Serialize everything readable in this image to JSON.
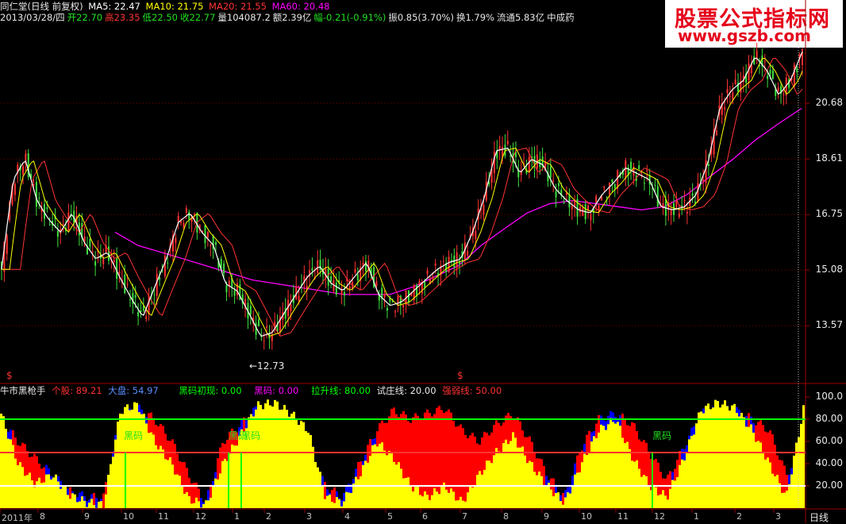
{
  "header": {
    "stock": "同仁堂(日线 前复权)",
    "ma5": "MA5: 22.47",
    "ma10": "MA10: 21.75",
    "ma20": "MA20: 21.55",
    "ma60": "MA60: 20.48",
    "date": "2013/03/28/四",
    "open": "开22.70",
    "high": "高23.35",
    "low": "低22.50",
    "close": "收22.77",
    "volume": "量104087.2",
    "amount": "额2.39亿",
    "change": "幅-0.21(-0.91%)",
    "amplitude": "振0.85(3.70%)",
    "turnover": "换1.79%",
    "float": "流通5.83亿",
    "industry": "中成药"
  },
  "watermark": {
    "line1": "股票公式指标网",
    "line2": "www.gszb.com"
  },
  "indicator_header": {
    "name": "牛市黑枪手",
    "ge_gu": "个股: 89.21",
    "da_pan": "大盘: 54.97",
    "hei_ma_chu_xian": "黑码初现: 0.00",
    "hei_ma": "黑码: 0.00",
    "la_sheng_xian": "拉升线: 80.00",
    "shi_zhuang_xian": "试庄线: 20.00",
    "qiang_ruo_xian": "强弱线: 50.00"
  },
  "price_ticks": [
    "20.68",
    "18.61",
    "16.75",
    "15.08",
    "13.57"
  ],
  "osc_ticks": [
    "100.0",
    "80.00",
    "60.00",
    "40.00",
    "20.00"
  ],
  "x_ticks": [
    "2011年",
    "8",
    "9",
    "10",
    "11",
    "12",
    "1",
    "2",
    "3",
    "4",
    "5",
    "6",
    "7",
    "8",
    "9",
    "10",
    "11",
    "12",
    "1",
    "2",
    "3"
  ],
  "period_label": "日线",
  "low_marker": "←12.73",
  "signal_labels": [
    "黑码",
    "黑码",
    "黑码",
    "黑码"
  ],
  "dollar_marks": [
    "$",
    "$"
  ],
  "colors": {
    "up": "#ff3232",
    "down": "#54fcfc",
    "ma5": "#ffffff",
    "ma10": "#ffff00",
    "ma20": "#ff3232",
    "ma60": "#ff00ff",
    "ge_gu": "#ffff00",
    "da_pan": "#ff0000",
    "blue": "#0000ff",
    "green": "#00ff00"
  },
  "chart_data": [
    {
      "type": "line",
      "title": "同仁堂(日线 前复权)",
      "y_scale": "log",
      "ylim": [
        12.5,
        23.5
      ],
      "x_labels": [
        "2011年",
        "8",
        "9",
        "10",
        "11",
        "12",
        "1",
        "2",
        "3",
        "4",
        "5",
        "6",
        "7",
        "8",
        "9",
        "10",
        "11",
        "12",
        "1",
        "2",
        "3"
      ],
      "series": [
        {
          "name": "close",
          "values": [
            15.1,
            17.9,
            18.6,
            17.2,
            16.6,
            16.2,
            16.8,
            15.9,
            15.4,
            15.6,
            14.9,
            14.3,
            13.8,
            14.6,
            15.4,
            16.5,
            16.8,
            16.2,
            15.8,
            14.7,
            14.5,
            13.9,
            13.3,
            13.4,
            13.9,
            14.4,
            14.9,
            15.2,
            14.7,
            14.5,
            14.9,
            15.3,
            14.4,
            14.1,
            14.2,
            14.5,
            14.8,
            15.1,
            15.3,
            15.4,
            16.2,
            17.3,
            18.9,
            19.0,
            18.1,
            18.6,
            18.4,
            17.6,
            17.2,
            16.9,
            16.8,
            17.4,
            17.8,
            18.3,
            18.1,
            17.9,
            17.0,
            16.9,
            17.0,
            17.4,
            18.5,
            20.5,
            21.2,
            21.6,
            22.6,
            22.0,
            21.0,
            21.6,
            22.8
          ]
        },
        {
          "name": "MA60",
          "values": [
            16.2,
            15.8,
            15.6,
            15.4,
            15.2,
            15.0,
            14.8,
            14.7,
            14.6,
            14.5,
            14.4,
            14.4,
            14.4,
            14.6,
            14.9,
            15.2,
            15.8,
            16.3,
            16.8,
            17.1,
            17.2,
            17.1,
            17.0,
            16.9,
            17.0,
            17.4,
            18.0,
            18.6,
            19.3,
            19.9,
            20.48
          ]
        }
      ]
    },
    {
      "type": "area",
      "title": "牛市黑枪手",
      "ylim": [
        0,
        100
      ],
      "reference_lines": {
        "拉升线": 80,
        "强弱线": 50,
        "试庄线": 20
      },
      "series": [
        {
          "name": "个股",
          "values": [
            85,
            40,
            22,
            30,
            12,
            5,
            3,
            88,
            93,
            60,
            40,
            8,
            3,
            40,
            65,
            92,
            95,
            85,
            70,
            10,
            5,
            30,
            60,
            45,
            20,
            10,
            20,
            5,
            30,
            50,
            65,
            40,
            20,
            5,
            40,
            70,
            80,
            45,
            20,
            10,
            45,
            88,
            95,
            90,
            70,
            40,
            10,
            89
          ]
        },
        {
          "name": "大盘",
          "values": [
            80,
            60,
            45,
            30,
            15,
            10,
            10,
            85,
            90,
            80,
            60,
            30,
            5,
            60,
            75,
            90,
            85,
            75,
            50,
            20,
            10,
            40,
            70,
            88,
            80,
            85,
            90,
            70,
            60,
            75,
            85,
            60,
            30,
            10,
            55,
            80,
            85,
            75,
            50,
            25,
            55,
            85,
            90,
            88,
            80,
            70,
            30,
            55
          ]
        }
      ]
    }
  ]
}
